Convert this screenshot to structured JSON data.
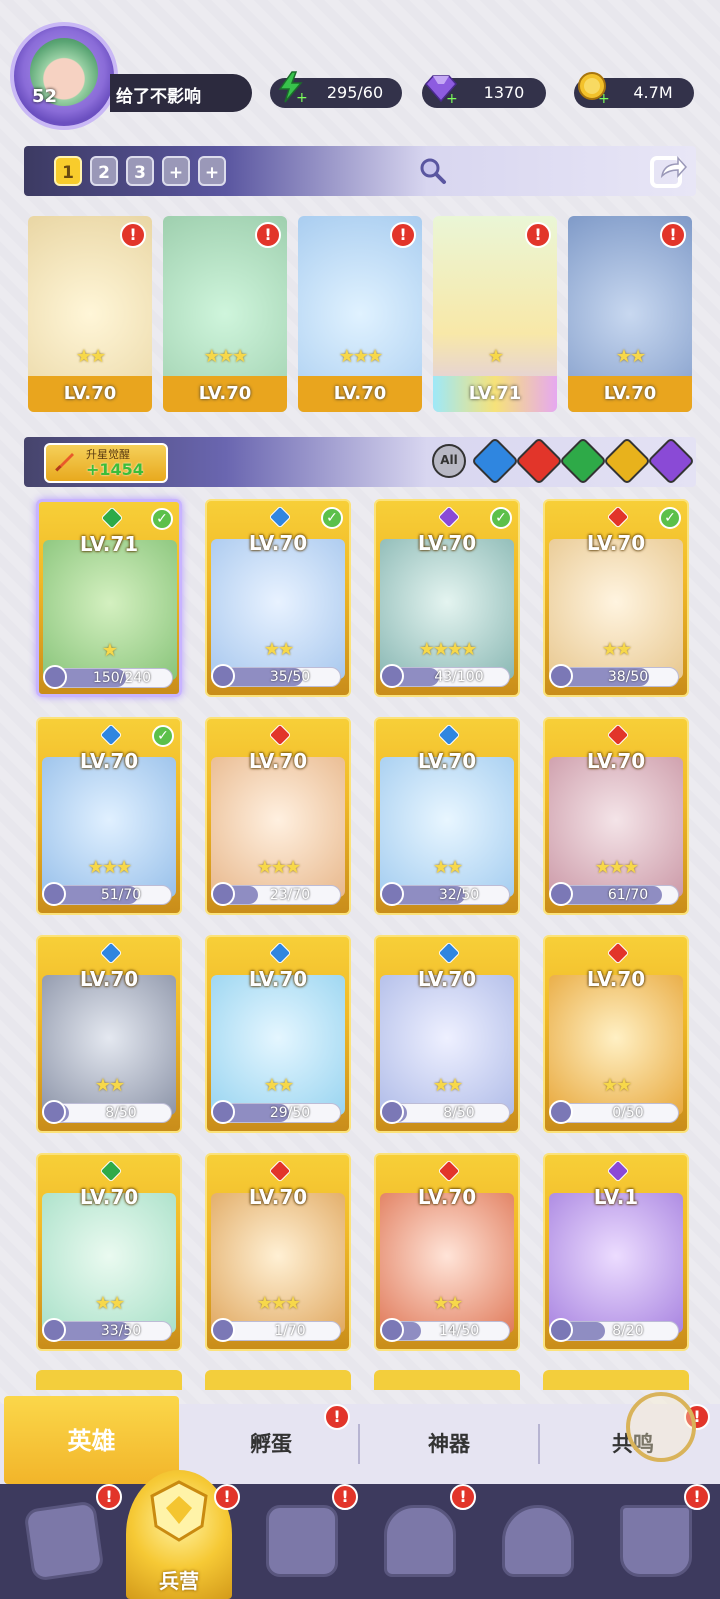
{
  "player": {
    "level": "52",
    "name": "给了不影响"
  },
  "resources": [
    {
      "icon": "lightning-icon",
      "value": "295/60"
    },
    {
      "icon": "diamond-icon",
      "value": "1370"
    },
    {
      "icon": "coin-icon",
      "value": "4.7M"
    }
  ],
  "team_tabs": [
    "1",
    "2",
    "3",
    "+",
    "+"
  ],
  "team": [
    {
      "level": "LV.70",
      "element": "fire",
      "stars": "★★"
    },
    {
      "level": "LV.70",
      "element": "dark",
      "stars": "★★★"
    },
    {
      "level": "LV.70",
      "element": "water",
      "stars": "★★★"
    },
    {
      "level": "LV.71",
      "element": "nature",
      "stars": "★"
    },
    {
      "level": "LV.70",
      "element": "water",
      "stars": "★★"
    }
  ],
  "upgrade": {
    "label": "升星觉醒",
    "value": "+1454"
  },
  "filters": {
    "all_label": "All"
  },
  "heroes": [
    {
      "level": "LV.71",
      "progress": "150/240",
      "stars": "★",
      "check": true
    },
    {
      "level": "LV.70",
      "progress": "35/50",
      "stars": "★★",
      "check": true
    },
    {
      "level": "LV.70",
      "progress": "43/100",
      "stars": "★★★★",
      "check": true
    },
    {
      "level": "LV.70",
      "progress": "38/50",
      "stars": "★★",
      "check": true
    },
    {
      "level": "LV.70",
      "progress": "51/70",
      "stars": "★★★",
      "check": true
    },
    {
      "level": "LV.70",
      "progress": "23/70",
      "stars": "★★★",
      "check": false
    },
    {
      "level": "LV.70",
      "progress": "32/50",
      "stars": "★★",
      "check": false
    },
    {
      "level": "LV.70",
      "progress": "61/70",
      "stars": "★★★",
      "check": false
    },
    {
      "level": "LV.70",
      "progress": "8/50",
      "stars": "★★",
      "check": false
    },
    {
      "level": "LV.70",
      "progress": "29/50",
      "stars": "★★",
      "check": false
    },
    {
      "level": "LV.70",
      "progress": "8/50",
      "stars": "★★",
      "check": false
    },
    {
      "level": "LV.70",
      "progress": "0/50",
      "stars": "★★",
      "check": false
    },
    {
      "level": "LV.70",
      "progress": "33/50",
      "stars": "★★",
      "check": false
    },
    {
      "level": "LV.70",
      "progress": "1/70",
      "stars": "★★★",
      "check": false
    },
    {
      "level": "LV.70",
      "progress": "14/50",
      "stars": "★★",
      "check": false
    },
    {
      "level": "LV.1",
      "progress": "8/20",
      "stars": "",
      "check": false
    }
  ],
  "subtabs": [
    "英雄",
    "孵蛋",
    "神器",
    "共鸣"
  ],
  "nav": {
    "active_label": "兵营"
  },
  "colors": {
    "fire": "#e2352a",
    "water": "#2f86e0",
    "nature": "#2eaa48",
    "light": "#e8b21c",
    "dark": "#8a4ad6",
    "accent": "#f6c42c"
  }
}
